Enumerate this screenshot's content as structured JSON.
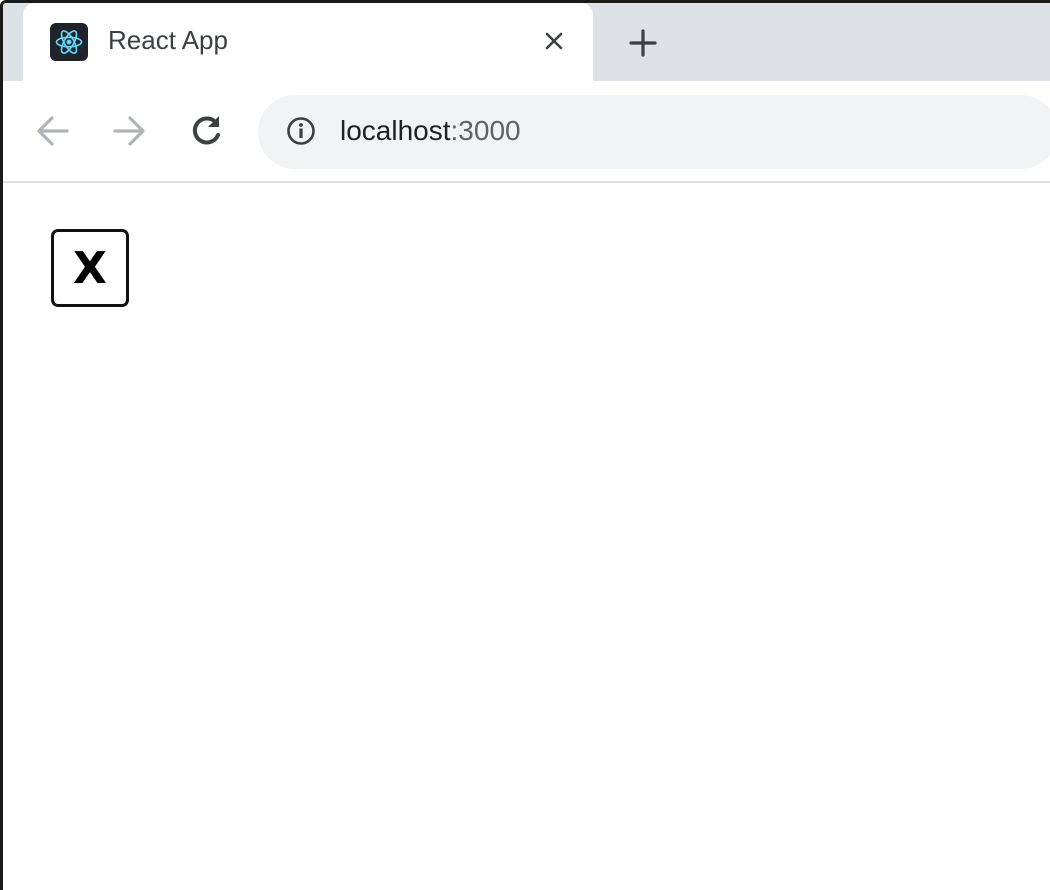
{
  "browser": {
    "tab": {
      "title": "React App",
      "favicon": "react-logo-icon",
      "close_icon": "close-icon"
    },
    "new_tab_icon": "plus-icon",
    "nav": {
      "back_icon": "arrow-left-icon",
      "forward_icon": "arrow-right-icon",
      "reload_icon": "reload-icon"
    },
    "address_bar": {
      "info_icon": "info-icon",
      "host": "localhost",
      "port": ":3000"
    }
  },
  "page": {
    "button_label": "X"
  },
  "colors": {
    "tabstrip": "#dee1e6",
    "omnibox": "#f1f3f4",
    "react_cyan": "#61dafb",
    "favicon_bg": "#20232a"
  }
}
